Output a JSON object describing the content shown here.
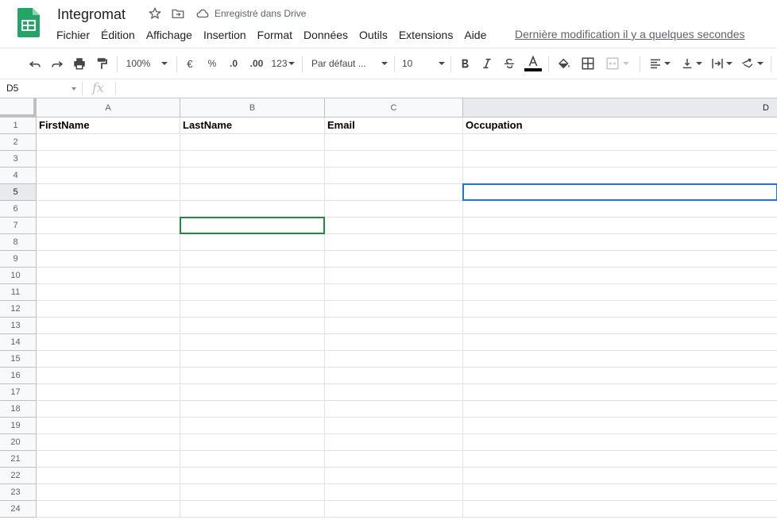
{
  "app": {
    "doc_title": "Integromat",
    "saved_status": "Enregistré dans Drive",
    "last_edit": "Dernière modification il y a quelques secondes",
    "accent_color": "#1a73e8",
    "brand_color": "#23a566"
  },
  "menu": [
    "Fichier",
    "Édition",
    "Affichage",
    "Insertion",
    "Format",
    "Données",
    "Outils",
    "Extensions",
    "Aide"
  ],
  "toolbar": {
    "zoom": "100%",
    "currency": "€",
    "percent": "%",
    "decrease_decimals": ".0",
    "increase_decimals": ".00",
    "more_formats": "123",
    "font": "Par défaut ...",
    "font_size": "10",
    "icons": [
      "undo-icon",
      "redo-icon",
      "print-icon",
      "paint-format-icon",
      "bold-icon",
      "italic-icon",
      "strikethrough-icon",
      "text-color-icon",
      "fill-color-icon",
      "borders-icon",
      "merge-cells-icon",
      "horizontal-align-icon",
      "vertical-align-icon",
      "text-wrap-icon",
      "text-rotation-icon"
    ]
  },
  "formula_bar": {
    "name_box": "D5",
    "fx_label": "fx",
    "value": ""
  },
  "sheet": {
    "columns": [
      "A",
      "B",
      "C",
      "D"
    ],
    "rows": [
      "1",
      "2",
      "3",
      "4",
      "5",
      "6",
      "7",
      "8",
      "9",
      "10",
      "11",
      "12",
      "13",
      "14",
      "15",
      "16",
      "17",
      "18",
      "19",
      "20",
      "21",
      "22",
      "23",
      "24"
    ],
    "header_row": [
      "FirstName",
      "LastName",
      "Email",
      "Occupation"
    ],
    "active_cell": "D5",
    "collaborator_cell": "B7",
    "collaborator_color": "#1e8e3e"
  }
}
